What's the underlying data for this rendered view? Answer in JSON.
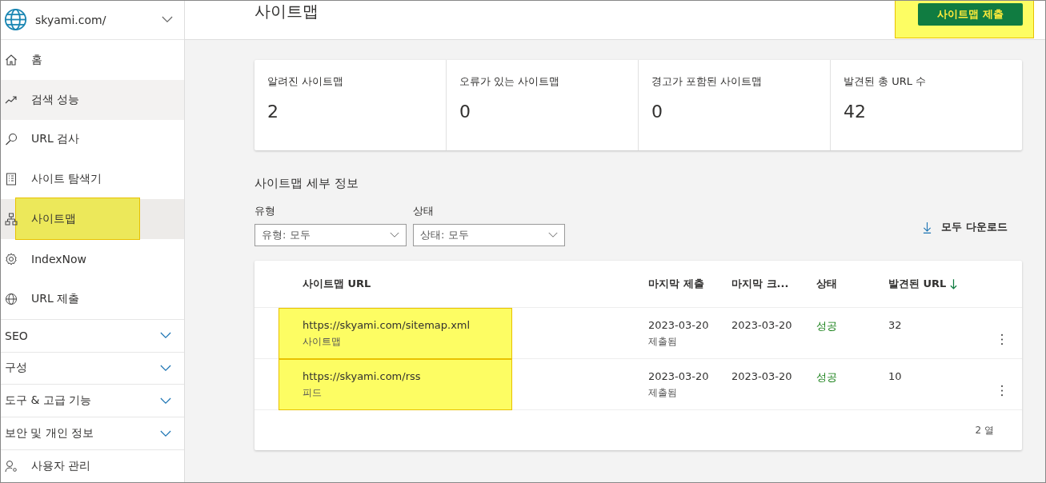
{
  "site": {
    "name": "skyami.com/"
  },
  "sidebar": {
    "items": [
      {
        "label": "홈",
        "selected": false,
        "highlighted": false
      },
      {
        "label": "검색 성능",
        "selected": false,
        "hover": true,
        "highlighted": false
      },
      {
        "label": "URL 검사",
        "selected": false,
        "highlighted": false
      },
      {
        "label": "사이트 탐색기",
        "selected": false,
        "highlighted": false
      },
      {
        "label": "사이트맵",
        "selected": true,
        "highlighted": true
      },
      {
        "label": "IndexNow",
        "selected": false,
        "highlighted": false
      },
      {
        "label": "URL 제출",
        "selected": false,
        "highlighted": false
      }
    ],
    "sections": [
      {
        "label": "SEO",
        "expanded": false
      },
      {
        "label": "구성",
        "expanded": false
      },
      {
        "label": "도구 & 고급 기능",
        "expanded": false
      },
      {
        "label": "보안 및 개인 정보",
        "expanded": false
      }
    ],
    "footer_item": {
      "label": "사용자 관리"
    }
  },
  "page": {
    "title": "사이트맵",
    "submit_button": {
      "label": "사이트맵 제출",
      "highlighted": true
    }
  },
  "stats": [
    {
      "label": "알려진 사이트맵",
      "value": "2"
    },
    {
      "label": "오류가 있는 사이트맵",
      "value": "0"
    },
    {
      "label": "경고가 포함된 사이트맵",
      "value": "0"
    },
    {
      "label": "발견된 총 URL 수",
      "value": "42"
    }
  ],
  "details": {
    "title": "사이트맵 세부 정보",
    "filters": [
      {
        "label": "유형",
        "value": "유형: 모두"
      },
      {
        "label": "상태",
        "value": "상태: 모두"
      }
    ],
    "download": "모두 다운로드"
  },
  "table": {
    "columns": [
      {
        "label": "사이트맵 URL",
        "sorted": false
      },
      {
        "label": "마지막 제출",
        "sorted": false
      },
      {
        "label": "마지막 크...",
        "sorted": false
      },
      {
        "label": "상태",
        "sorted": false
      },
      {
        "label": "발견된 URL",
        "sorted": true
      }
    ],
    "rows": [
      {
        "url": "https://skyami.com/sitemap.xml",
        "type": "사이트맵",
        "submitted": "2023-03-20",
        "submitted_note": "제출됨",
        "crawled": "2023-03-20",
        "status": "성공",
        "urls": "32",
        "highlighted": true
      },
      {
        "url": "https://skyami.com/rss",
        "type": "피드",
        "submitted": "2023-03-20",
        "submitted_note": "제출됨",
        "crawled": "2023-03-20",
        "status": "성공",
        "urls": "10",
        "highlighted": true
      }
    ],
    "footer": "2 열"
  }
}
